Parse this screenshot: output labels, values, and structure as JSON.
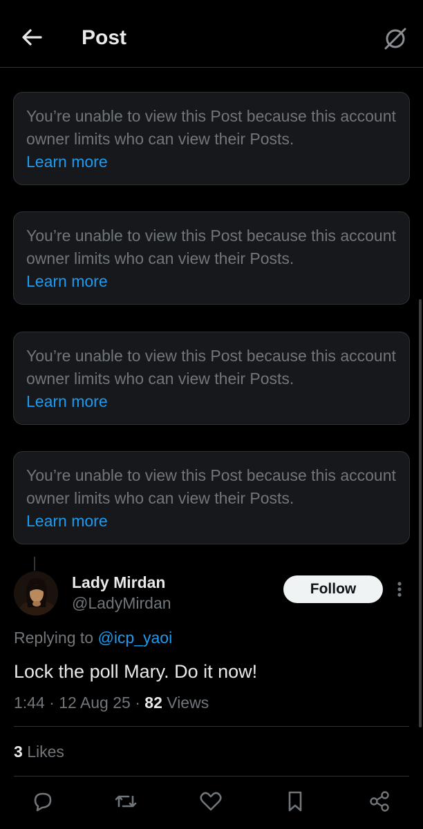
{
  "header": {
    "title": "Post",
    "back_icon": "arrow-left-icon",
    "right_icon": "circle-slash-icon"
  },
  "cards": [
    {
      "text": "You’re unable to view this Post because this account owner limits who can view their Posts.",
      "link": "Learn more"
    },
    {
      "text": "You’re unable to view this Post because this account owner limits who can view their Posts.",
      "link": "Learn more"
    },
    {
      "text": "You’re unable to view this Post because this account owner limits who can view their Posts.",
      "link": "Learn more"
    },
    {
      "text": "You’re unable to view this Post because this account owner limits who can view their Posts.",
      "link": "Learn more"
    }
  ],
  "post": {
    "author_name": "Lady Mirdan",
    "author_handle": "@LadyMirdan",
    "follow_label": "Follow",
    "replying_prefix": "Replying to",
    "replying_handle": "@icp_yaoi",
    "text": "Lock the poll Mary. Do it now!",
    "time": "1:44",
    "sep1": "·",
    "date": "12 Aug 25",
    "sep2": "·",
    "views_count": "82",
    "views_label": "Views",
    "likes_count": "3",
    "likes_label": "Likes"
  },
  "actions": [
    "reply-icon",
    "repost-icon",
    "like-icon",
    "bookmark-icon",
    "share-icon"
  ],
  "colors": {
    "background": "#000000",
    "card_bg": "#16181c",
    "muted_text": "#71767b",
    "link": "#1d9bf0",
    "primary_text": "#e7e9ea"
  }
}
